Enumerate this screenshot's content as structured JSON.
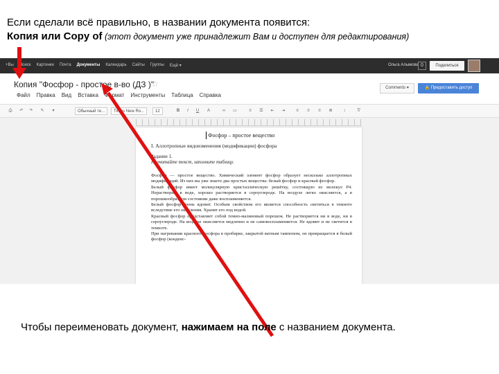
{
  "slide": {
    "line1": "Если сделали всё правильно, в названии документа появится:",
    "line2_bold": "Копия или Copy of",
    "line2_note": " (этот документ уже принадлежит Вам и доступен для редактирования)",
    "bottom_pre": "Чтобы переименовать документ, ",
    "bottom_bold1": "нажимаем на поле",
    "bottom_post": " с названием документа."
  },
  "google_bar": {
    "nav": [
      "+Вы",
      "Поиск",
      "Картинки",
      "Почта",
      "Документы",
      "Календарь",
      "Сайты",
      "Группы",
      "Ещё ▾"
    ],
    "active_index": 4,
    "user": "Ольга Алымова",
    "share_label": "Поделиться"
  },
  "document": {
    "title": "Копия \"Фосфор - простое в-во (ДЗ )\"",
    "menu": [
      "Файл",
      "Правка",
      "Вид",
      "Вставка",
      "Формат",
      "Инструменты",
      "Таблица",
      "Справка"
    ],
    "comments_label": "Comments ▾",
    "access_label": "Предоставить доступ"
  },
  "toolbar": {
    "style": "Обычный те...",
    "font": "Times New Ro...",
    "size": "12"
  },
  "page": {
    "title": "Фосфор – простое вещество",
    "section": "I. Аллотропные видоизменения (модификации) фосфора",
    "task": "Задание 1.",
    "instruction": "Прочитайте текст, заполните таблицу.",
    "body": "Фосфор — простое вещество. Химический элемент фосфор образует несколько аллотропных модификаций. Из них вы уже знаете два простых вещества: белый фосфор и красный фосфор.\nБелый фосфор имеет молекулярную кристаллическую решётку, состоящую из молекул P4. Нерастворим в воде, хорошо растворяется в сероуглероде. На воздухе легко окисляется, а в порошкообразном состоянии даже воспламеняется.\nБелый фосфор очень ядовит. Особым свойством его является способность светиться в темноте вследствие его окисления. Хранят его под водой.\nКрасный фосфор представляет собой темно-малиновый порошок. Не растворяется ни в воде, ни в сероуглероде. На воздухе окисляется медленно и не самовоспламеняется. Не ядовит и не светится в темноте.\nПри нагревании красного фосфора в пробирке, закрытой ватным тампоном, он превращается в белый фосфор (конденс-"
  },
  "colors": {
    "arrow": "#e01010",
    "dark_bar": "#2d2d2d",
    "access_button": "#4a84d9"
  }
}
